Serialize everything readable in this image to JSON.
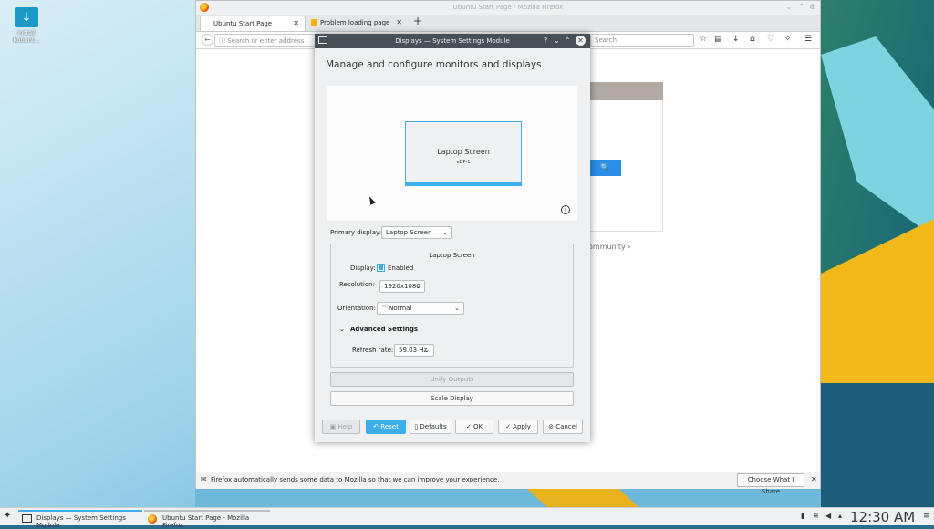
{
  "desktop": {
    "icon_label": "Install Kubunt..."
  },
  "firefox": {
    "window_title": "Ubuntu Start Page - Mozilla Firefox",
    "tabs": [
      {
        "label": "Ubuntu Start Page",
        "active": true
      },
      {
        "label": "Problem loading page",
        "active": false
      }
    ],
    "url_placeholder": "Search or enter address",
    "search_placeholder": "Search",
    "search_button_glyph": "🔍",
    "community_link": "ommunity ›",
    "notification": {
      "message": "Firefox automatically sends some data to Mozilla so that we can improve your experience.",
      "button": "Choose What I Share"
    }
  },
  "dialog": {
    "title": "Displays — System Settings Module",
    "heading": "Manage and configure monitors and displays",
    "monitor": {
      "name": "Laptop Screen",
      "output": "eDP-1"
    },
    "primary_label": "Primary display:",
    "primary_value": "Laptop Screen",
    "group_title": "Laptop Screen",
    "display_label": "Display:",
    "enabled_label": "Enabled",
    "enabled": true,
    "resolution_label": "Resolution:",
    "resolution_value": "1920x1080",
    "orientation_label": "Orientation:",
    "orientation_value": "Normal",
    "advanced_label": "Advanced Settings",
    "refresh_label": "Refresh rate:",
    "refresh_value": "59.03 Hz",
    "unify_button": "Unify Outputs",
    "scale_button": "Scale Display",
    "buttons": {
      "help": "Help",
      "reset": "Reset",
      "defaults": "Defaults",
      "ok": "OK",
      "apply": "Apply",
      "cancel": "Cancel"
    }
  },
  "taskbar": {
    "tasks": [
      {
        "label": "Displays — System Settings Module",
        "active": true
      },
      {
        "label": "Ubuntu Start Page - Mozilla Firefox",
        "active": false
      }
    ],
    "clock": "12:30 AM"
  },
  "colors": {
    "accent": "#3daee9",
    "titlebar": "#475057",
    "panel": "#eff0f1"
  }
}
